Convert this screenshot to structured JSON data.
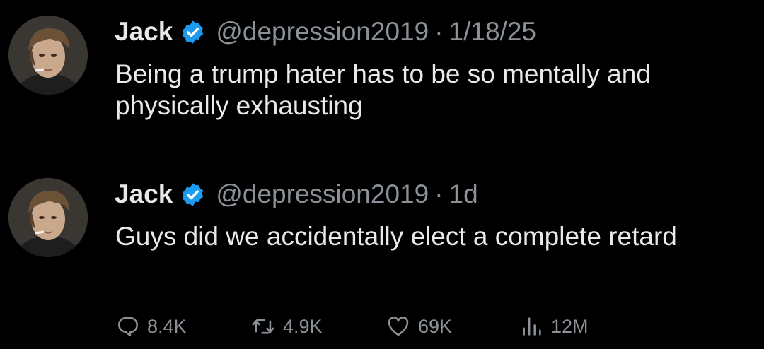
{
  "tweets": [
    {
      "author_name": "Jack",
      "handle": "@depression2019",
      "separator": "·",
      "time": "1/18/25",
      "text": "Being a trump hater has to be so mentally and physically exhausting",
      "avatar_icon": "profile-photo"
    },
    {
      "author_name": "Jack",
      "handle": "@depression2019",
      "separator": "·",
      "time": "1d",
      "text": "Guys did we accidentally elect a complete retard",
      "avatar_icon": "profile-photo"
    }
  ],
  "actions": {
    "replies": "8.4K",
    "retweets": "4.9K",
    "likes": "69K",
    "views": "12M"
  },
  "colors": {
    "background": "#000000",
    "text": "#e7e9ea",
    "muted": "#8b9197",
    "verified_badge": "#1d9bf0"
  },
  "icons": {
    "reply": "reply-icon",
    "retweet": "retweet-icon",
    "like": "like-icon",
    "views": "views-icon",
    "verified": "verified-badge-icon"
  }
}
